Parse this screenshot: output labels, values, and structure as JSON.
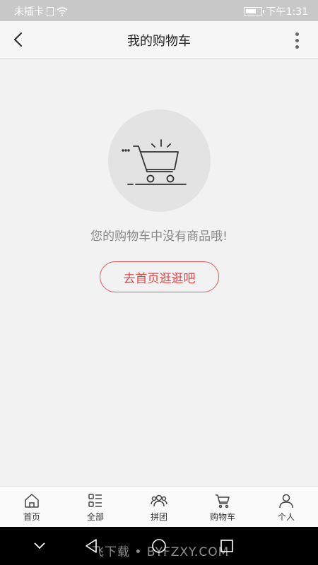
{
  "status_bar": {
    "carrier": "未插卡",
    "time": "下午1:31"
  },
  "nav": {
    "title": "我的购物车"
  },
  "empty_state": {
    "message": "您的购物车中没有商品哦!",
    "button_label": "去首页逛逛吧"
  },
  "tabs": [
    {
      "label": "首页",
      "icon": "home-icon"
    },
    {
      "label": "全部",
      "icon": "category-list-icon"
    },
    {
      "label": "拼团",
      "icon": "group-icon"
    },
    {
      "label": "购物车",
      "icon": "cart-icon"
    },
    {
      "label": "个人",
      "icon": "user-icon"
    }
  ],
  "watermark": "飞下载 • BYFZXY.COM"
}
